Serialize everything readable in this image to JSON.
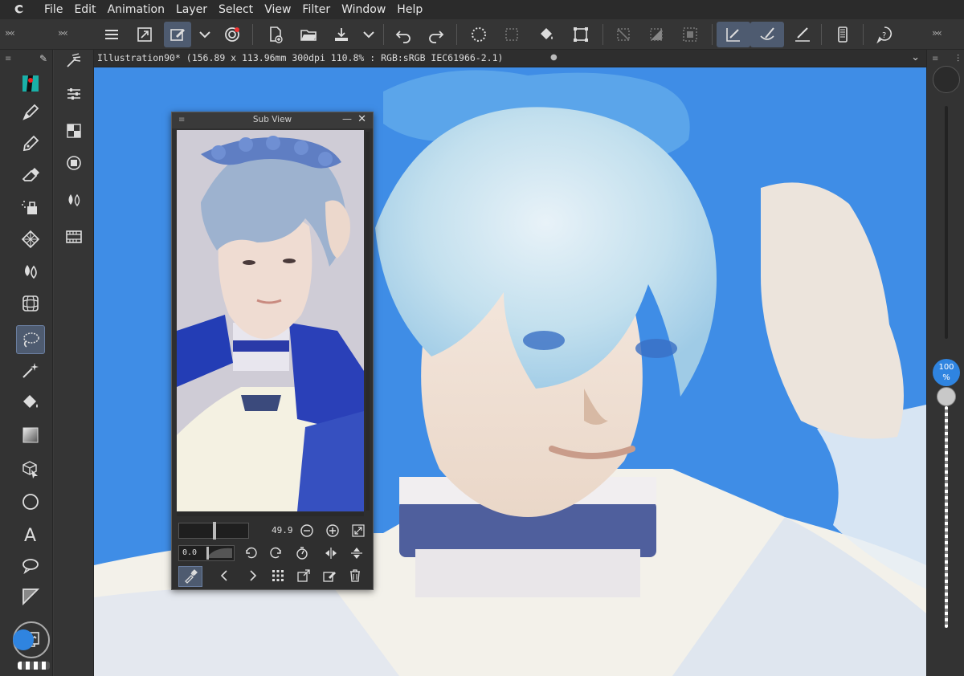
{
  "menubar": {
    "items": [
      "File",
      "Edit",
      "Animation",
      "Layer",
      "Select",
      "View",
      "Filter",
      "Window",
      "Help"
    ]
  },
  "commandbar": {
    "icons": [
      "menu-icon",
      "canvas-resize-icon",
      "edit-image-icon",
      "chevron-down-icon",
      "cloud-sync-icon",
      "new-file-icon",
      "open-folder-icon",
      "save-icon",
      "chevron-down-icon",
      "undo-icon",
      "redo-icon",
      "loading-icon",
      "select-all-icon",
      "fill-icon",
      "transform-icon",
      "clear-selection-icon",
      "fill-selection-icon",
      "invert-selection-icon",
      "ruler-snap-icon",
      "special-ruler-snap-icon",
      "grid-snap-icon",
      "smartphone-icon",
      "help-icon"
    ]
  },
  "tools": {
    "items": [
      "color-swatch-icon",
      "pen-icon",
      "pencil-icon",
      "eraser-icon",
      "airbrush-icon",
      "pattern-icon",
      "blend-icon",
      "grid-icon",
      "lasso-icon",
      "magic-wand-icon",
      "fill-bucket-icon",
      "gradient-icon",
      "3d-cube-icon",
      "ellipse-icon",
      "text-icon",
      "speech-balloon-icon",
      "frame-border-icon"
    ],
    "active": "lasso-icon"
  },
  "canvas": {
    "title": "Illustration90* (156.89 x 113.96mm 300dpi 110.8% : RGB:sRGB IEC61966-2.1)",
    "close": "●",
    "background_color": "#3f8de6"
  },
  "subview": {
    "title": "Sub View",
    "zoom_value": "49.9",
    "rotation_value": "0.0"
  },
  "rightpanel": {
    "opacity_value": "100",
    "opacity_unit": "%"
  }
}
